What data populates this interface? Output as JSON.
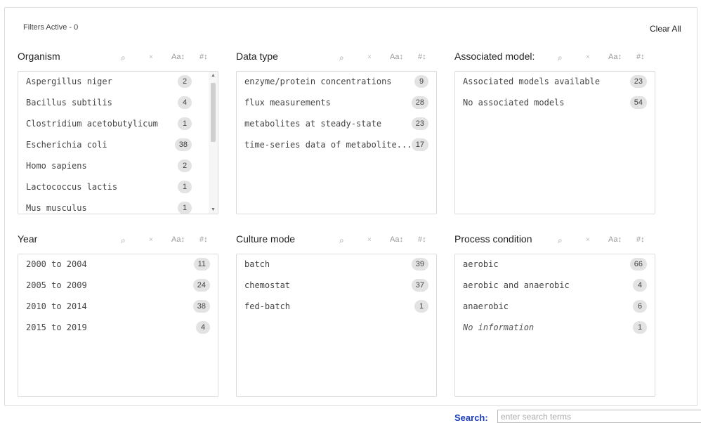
{
  "header": {
    "filters_active": "Filters Active - 0",
    "clear_all": "Clear All"
  },
  "tools": {
    "search": "⌕",
    "clear": "×",
    "sort_alpha": "Aa↕",
    "sort_count": "#↕"
  },
  "facets": [
    {
      "title": "Organism",
      "scrollable": true,
      "items": [
        {
          "label": "Aspergillus niger",
          "count": "2"
        },
        {
          "label": "Bacillus subtilis",
          "count": "4"
        },
        {
          "label": "Clostridium acetobutylicum",
          "count": "1"
        },
        {
          "label": "Escherichia coli",
          "count": "38"
        },
        {
          "label": "Homo sapiens",
          "count": "2"
        },
        {
          "label": "Lactococcus lactis",
          "count": "1"
        },
        {
          "label": "Mus musculus",
          "count": "1"
        }
      ]
    },
    {
      "title": "Data type",
      "items": [
        {
          "label": "enzyme/protein concentrations",
          "count": "9"
        },
        {
          "label": "flux measurements",
          "count": "28"
        },
        {
          "label": "metabolites at steady-state",
          "count": "23"
        },
        {
          "label": "time-series data of metabolite...",
          "count": "17"
        }
      ]
    },
    {
      "title": "Associated model:",
      "items": [
        {
          "label": "Associated models available",
          "count": "23"
        },
        {
          "label": "No associated models",
          "count": "54"
        }
      ]
    },
    {
      "title": "Year",
      "items": [
        {
          "label": "2000 to 2004",
          "count": "11"
        },
        {
          "label": "2005 to 2009",
          "count": "24"
        },
        {
          "label": "2010 to 2014",
          "count": "38"
        },
        {
          "label": "2015 to 2019",
          "count": "4"
        }
      ]
    },
    {
      "title": "Culture mode",
      "items": [
        {
          "label": "batch",
          "count": "39"
        },
        {
          "label": "chemostat",
          "count": "37"
        },
        {
          "label": "fed-batch",
          "count": "1"
        }
      ]
    },
    {
      "title": "Process condition",
      "items": [
        {
          "label": "aerobic",
          "count": "66"
        },
        {
          "label": "aerobic and anaerobic",
          "count": "4"
        },
        {
          "label": "anaerobic",
          "count": "6"
        },
        {
          "label": "No information",
          "count": "1",
          "italic": true
        }
      ]
    }
  ],
  "search": {
    "label": "Search:",
    "placeholder": "enter search terms"
  }
}
